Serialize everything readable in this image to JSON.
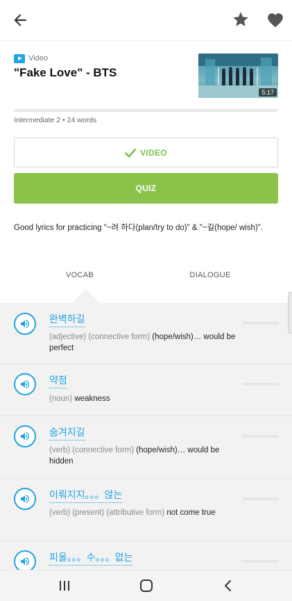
{
  "header": {
    "type_label": "Video",
    "title": "\"Fake Love\" - BTS",
    "duration": "5:17",
    "meta": "Intermediate 2 • 24 words"
  },
  "actions": {
    "video_label": "VIDEO",
    "quiz_label": "QUIZ"
  },
  "description": "Good lyrics for practicing \"~려 하다(plan/try to do)\" & \"~길(hope/ wish)\".",
  "tabs": [
    {
      "label": "VOCAB",
      "selected": true
    },
    {
      "label": "DIALOGUE",
      "selected": false
    }
  ],
  "vocab": [
    {
      "word": "완벽하길",
      "grammar": "(adjective)  (connective form)",
      "meaning": "(hope/wish)… would be perfect"
    },
    {
      "word": "약점",
      "grammar": "(noun)",
      "meaning": "weakness"
    },
    {
      "word": "숨겨지길",
      "grammar": "(verb)  (connective form)",
      "meaning": "(hope/wish)… would be hidden"
    },
    {
      "word": "이뤄지지。。。않는",
      "grammar": "(verb) (present) (attributive form)",
      "meaning": "not come true"
    },
    {
      "word": "피울。。。수。。。없는",
      "grammar": "",
      "meaning": ""
    }
  ],
  "icons": {
    "back": "arrow-left-icon",
    "favorite": "star-icon",
    "like": "heart-icon",
    "speaker": "speaker-icon",
    "check": "check-icon",
    "video_type": "play-icon"
  },
  "colors": {
    "accent_blue": "#1fa3e3",
    "green": "#8bc34a",
    "green_text": "#7cc24a"
  }
}
